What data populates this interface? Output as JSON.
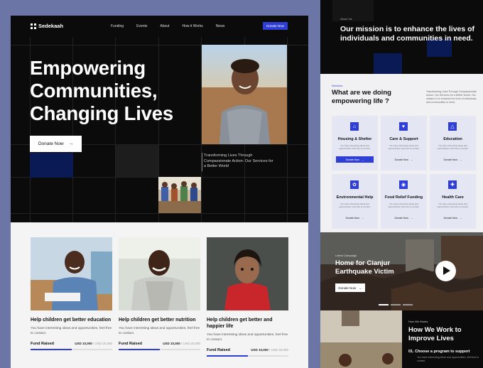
{
  "brand": {
    "name": "Sedekaah",
    "accent": "#2f3fd6"
  },
  "nav": {
    "links": [
      "Funding",
      "Events",
      "About",
      "How it Works",
      "News"
    ],
    "cta": "Donate Now"
  },
  "hero": {
    "title_lines": [
      "Empowering",
      "Communities,",
      "Changing Lives"
    ],
    "cta": "Donate Now",
    "caption": "Transforming Lives Through Compassionate Action: Our Services for a Better World"
  },
  "campaigns": [
    {
      "title": "Help children get better education",
      "desc": "You have interesting ideas and opportunities, feel free to contact.",
      "fund_label": "Fund Raised",
      "raised": "USD 10,000",
      "goal": "/ USD 20,000",
      "progress": 0.5
    },
    {
      "title": "Help children get better nutrition",
      "desc": "You have interesting ideas and opportunities, feel free to contact.",
      "fund_label": "Fund Raised",
      "raised": "USD 10,000",
      "goal": "/ USD 20,000",
      "progress": 0.5
    },
    {
      "title": "Help children get better and happier life",
      "desc": "You have interesting ideas and opportunities, feel free to contact.",
      "fund_label": "Fund Raised",
      "raised": "USD 10,000",
      "goal": "/ USD 20,000",
      "progress": 0.5
    }
  ],
  "mission": {
    "tag": "About Us",
    "text": "Our mission is to enhance the lives of individuals and communities in need."
  },
  "services": {
    "tag": "Services",
    "title": "What are we doing empowering life ?",
    "desc": "Transforming Lives Through Compassionate Action: Our Services for a Better World. Our mission is to enhance the lives of individuals and communities in need.",
    "items": [
      {
        "name": "Housing & Shelter",
        "icon": "house-icon",
        "text": "You have interesting ideas and opportunities, feel free to contact.",
        "btn": "Donate Now",
        "primary": true
      },
      {
        "name": "Care & Support",
        "icon": "heart-icon",
        "text": "You have interesting ideas and opportunities, feel free to contact.",
        "btn": "Donate Now",
        "primary": false
      },
      {
        "name": "Education",
        "icon": "graduation-icon",
        "text": "You have interesting ideas and opportunities, feel free to contact.",
        "btn": "Donate Now",
        "primary": false
      },
      {
        "name": "Environmental Help",
        "icon": "leaf-icon",
        "text": "You have interesting ideas and opportunities, feel free to contact.",
        "btn": "Donate Now",
        "primary": false
      },
      {
        "name": "Food Relief Funding",
        "icon": "food-icon",
        "text": "You have interesting ideas and opportunities, feel free to contact.",
        "btn": "Donate Now",
        "primary": false
      },
      {
        "name": "Health Care",
        "icon": "health-icon",
        "text": "You have interesting ideas and opportunities, feel free to contact.",
        "btn": "Donate Now",
        "primary": false
      }
    ]
  },
  "latest": {
    "tag": "Latest Campaign",
    "title": "Home for Cianjur Earthquake Victim",
    "cta": "Donate Now"
  },
  "how": {
    "tag": "How We Works",
    "title": "How We Work to Improve Lives",
    "step": "01.  Choose a program to support",
    "step_desc": "You have interesting ideas and opportunities, feel free to contact."
  }
}
